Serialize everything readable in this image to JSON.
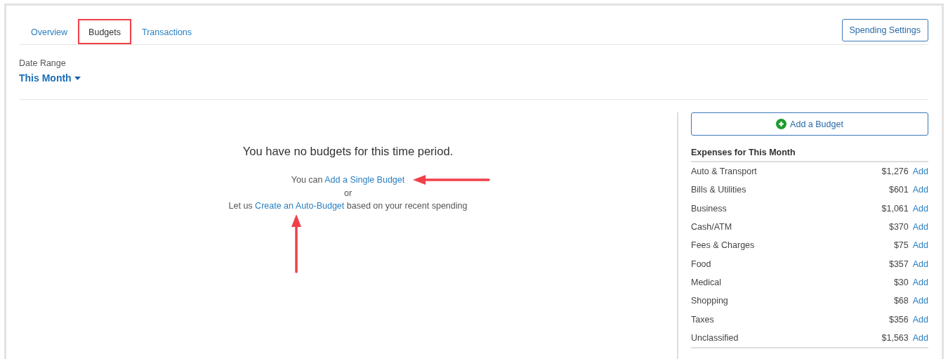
{
  "tabs": [
    {
      "label": "Overview",
      "selected": false,
      "highlighted": false
    },
    {
      "label": "Budgets",
      "selected": true,
      "highlighted": true
    },
    {
      "label": "Transactions",
      "selected": false,
      "highlighted": false
    }
  ],
  "settings_button": "Spending Settings",
  "date_range": {
    "label": "Date Range",
    "value": "This Month"
  },
  "empty_state": {
    "title": "You have no budgets for this time period.",
    "lines": [
      {
        "kind": "leftarrow",
        "before": "You can",
        "link": "Add a Single Budget"
      },
      {
        "kind": "plain",
        "before": "or"
      },
      {
        "kind": "uparrow",
        "before": "Let us",
        "link": "Create an Auto-Budget",
        "after": "based on your recent spending"
      }
    ]
  },
  "add_budget_button": "Add a Budget",
  "expenses": {
    "title": "Expenses for This Month",
    "rows": [
      {
        "category": "Auto & Transport",
        "amount": "$1,276",
        "action": "Add"
      },
      {
        "category": "Bills & Utilities",
        "amount": "$601",
        "action": "Add"
      },
      {
        "category": "Business",
        "amount": "$1,061",
        "action": "Add"
      },
      {
        "category": "Cash/ATM",
        "amount": "$370",
        "action": "Add"
      },
      {
        "category": "Fees & Charges",
        "amount": "$75",
        "action": "Add"
      },
      {
        "category": "Food",
        "amount": "$357",
        "action": "Add"
      },
      {
        "category": "Medical",
        "amount": "$30",
        "action": "Add"
      },
      {
        "category": "Shopping",
        "amount": "$68",
        "action": "Add"
      },
      {
        "category": "Taxes",
        "amount": "$356",
        "action": "Add"
      },
      {
        "category": "Unclassified",
        "amount": "$1,563",
        "action": "Add"
      }
    ]
  }
}
